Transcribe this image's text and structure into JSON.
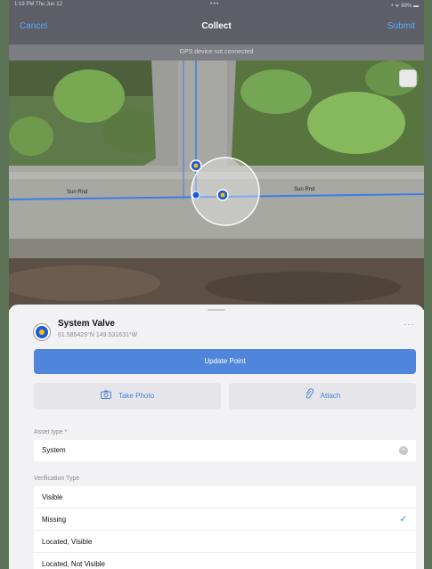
{
  "status_bar": {
    "time_date": "1:19 PM  Thu Jun 12",
    "right": "• ᯤ 89% ▬"
  },
  "nav": {
    "cancel": "Cancel",
    "title": "Collect",
    "submit": "Submit"
  },
  "gps_banner": "GPS device not connected",
  "map": {
    "street_labels": [
      "Sun Rnd",
      "Sun Rnd"
    ]
  },
  "feature": {
    "name": "System Valve",
    "coordinates": "61.585429°N  149.531631°W",
    "more": "···"
  },
  "actions": {
    "update": "Update Point",
    "take_photo": "Take Photo",
    "attach": "Attach"
  },
  "asset_type": {
    "label": "Asset type *",
    "value": "System"
  },
  "verification": {
    "label": "Verification Type",
    "options": [
      "Visible",
      "Missing",
      "Located, Visible",
      "Located, Not Visible"
    ],
    "selected_index": 1
  },
  "colors": {
    "accent": "#4f86db",
    "point": "#1e5ad8",
    "line": "#3f7be8"
  },
  "icons": [
    "camera-icon",
    "paperclip-icon",
    "checkmark-icon",
    "clear-icon",
    "more-icon"
  ]
}
